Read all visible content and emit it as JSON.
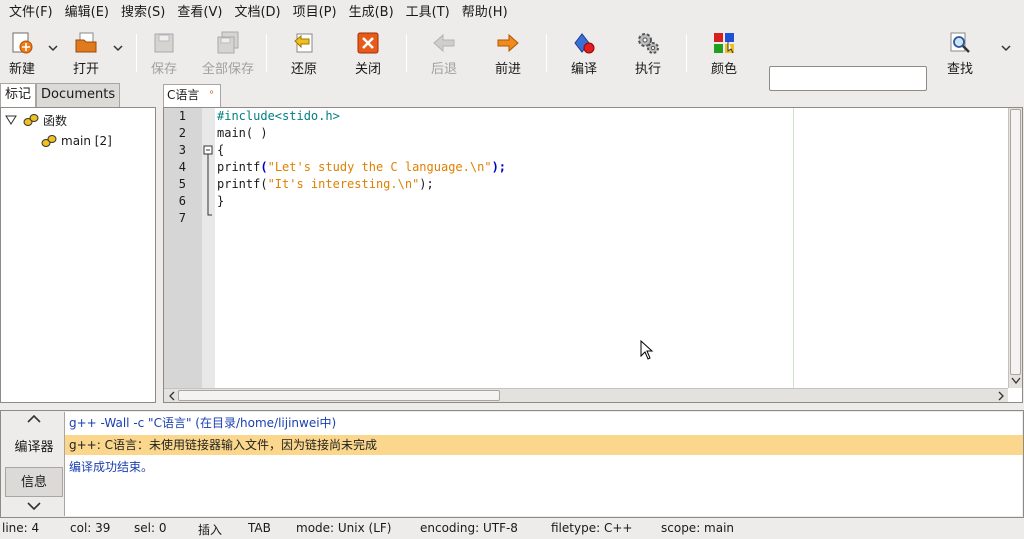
{
  "menu": [
    "文件(F)",
    "编辑(E)",
    "搜索(S)",
    "查看(V)",
    "文档(D)",
    "项目(P)",
    "生成(B)",
    "工具(T)",
    "帮助(H)"
  ],
  "toolbar": {
    "new_label": "新建",
    "open_label": "打开",
    "save_label": "保存",
    "save_all_label": "全部保存",
    "revert_label": "还原",
    "close_label": "关闭",
    "back_label": "后退",
    "forward_label": "前进",
    "compile_label": "编译",
    "execute_label": "执行",
    "color_label": "颜色",
    "search_value": "",
    "find_label": "查找"
  },
  "sidebar": {
    "tabs": [
      "标记",
      "Documents"
    ],
    "tree": {
      "group_label": "函数",
      "item_label": "main [2]"
    }
  },
  "editor": {
    "tab_label": "C语言",
    "line_numbers": [
      "1",
      "2",
      "3",
      "4",
      "5",
      "6",
      "7"
    ],
    "code": {
      "l1": "#include<stido.h>",
      "l2": "main( )",
      "l3": "{",
      "l4_fn": "printf",
      "l4_open": "(",
      "l4_str": "\"Let's study the C language.\\n\"",
      "l4_close": ");",
      "l5_fn": "printf(",
      "l5_str": "\"It's interesting.\\n\"",
      "l5_close": ");",
      "l6": "}"
    }
  },
  "messages": {
    "side_up": "∧",
    "side_compiler": "编译器",
    "side_info": "信息",
    "side_down": "∨",
    "lines": [
      "g++ -Wall -c \"C语言\" (在目录/home/lijinwei中)",
      "g++: C语言：未使用链接器输入文件，因为链接尚未完成",
      "编译成功结束。"
    ]
  },
  "status": {
    "line": "line: 4",
    "col": "col: 39",
    "sel": "sel: 0",
    "insert": "插入",
    "tab": "TAB",
    "mode": "mode: Unix (LF)",
    "encoding": "encoding: UTF-8",
    "filetype": "filetype: C++",
    "scope": "scope: main"
  },
  "colors": {
    "highlight_row": "#fad78c",
    "message_blue": "#1a3fb0"
  }
}
